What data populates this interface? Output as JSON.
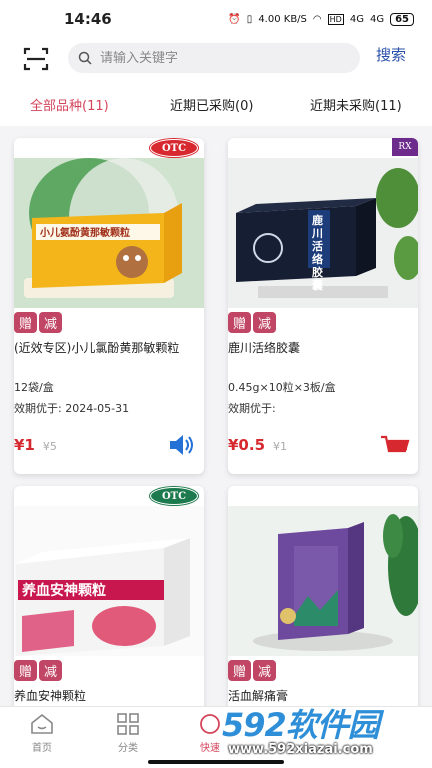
{
  "status": {
    "time": "14:46",
    "network": "4.00 KB/S",
    "hd": "HD",
    "signal1": "4G",
    "signal2": "4G",
    "battery": "65"
  },
  "search": {
    "placeholder": "请输入关键字",
    "button": "搜索"
  },
  "tabs": [
    {
      "label": "全部品种(11)",
      "active": true
    },
    {
      "label": "近期已采购(0)",
      "active": false
    },
    {
      "label": "近期未采购(11)",
      "active": false
    }
  ],
  "products": [
    {
      "badge": "OTC",
      "tag_gift": "赠",
      "tag_discount": "减",
      "name": "(近效专区)小儿氯酚黄那敏颗粒",
      "spec": "12袋/盒",
      "expiry": "效期优于: 2024-05-31",
      "price": "¥1",
      "original_price": "¥5",
      "box_text": "小儿氨酚黄那敏颗粒"
    },
    {
      "badge": "RX",
      "tag_gift": "赠",
      "tag_discount": "减",
      "name": "鹿川活络胶囊",
      "spec": "0.45g×10粒×3板/盒",
      "expiry": "效期优于:",
      "price": "¥0.5",
      "original_price": "¥1",
      "box_text": "鹿川活络胶囊"
    },
    {
      "badge": "OTC",
      "tag_gift": "赠",
      "tag_discount": "减",
      "name": "养血安神颗粒",
      "box_text": "养血安神颗粒"
    },
    {
      "badge": "",
      "tag_gift": "赠",
      "tag_discount": "减",
      "name": "活血解痛膏"
    }
  ],
  "nav": [
    {
      "label": "首页",
      "icon": "home-icon"
    },
    {
      "label": "分类",
      "icon": "grid-icon"
    },
    {
      "label": "快速",
      "icon": "flash-icon"
    }
  ],
  "watermark": {
    "logo": "592软件园",
    "url": "www.592xiazai.com"
  },
  "colors": {
    "accent": "#d4455c",
    "tag": "#c14564",
    "price": "#d7282f",
    "link": "#2a4fa8"
  }
}
